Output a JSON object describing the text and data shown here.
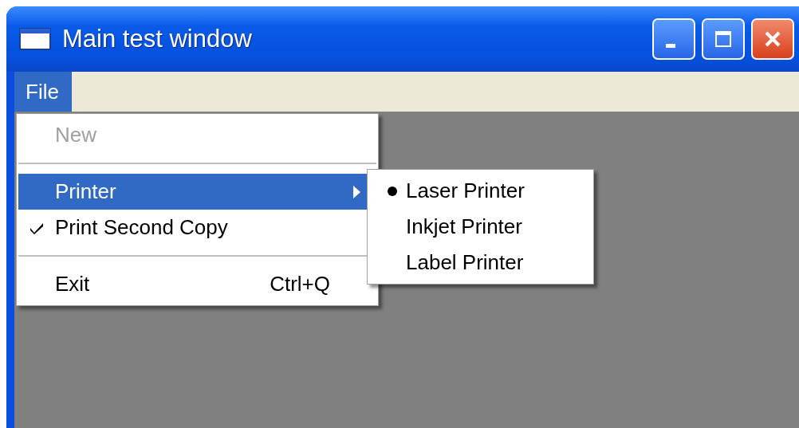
{
  "window": {
    "title": "Main test window"
  },
  "menu_bar": [
    {
      "label": "File",
      "selected": true
    }
  ],
  "menu": {
    "items": [
      {
        "kind": "item",
        "label": "New",
        "disabled": true,
        "selected": false,
        "checked": false,
        "submenu": false
      },
      {
        "kind": "separator"
      },
      {
        "kind": "item",
        "label": "Printer",
        "disabled": false,
        "selected": true,
        "checked": false,
        "submenu": true
      },
      {
        "kind": "item",
        "label": "Print Second Copy",
        "disabled": false,
        "selected": false,
        "checked": true,
        "submenu": false
      },
      {
        "kind": "separator"
      },
      {
        "kind": "item",
        "label": "Exit",
        "shortcut": "Ctrl+Q",
        "disabled": false,
        "selected": false,
        "checked": false,
        "submenu": false
      }
    ]
  },
  "submenu": {
    "items": [
      {
        "label": "Laser Printer",
        "selected": true
      },
      {
        "label": "Inkjet Printer",
        "selected": false
      },
      {
        "label": "Label Printer",
        "selected": false
      }
    ]
  }
}
